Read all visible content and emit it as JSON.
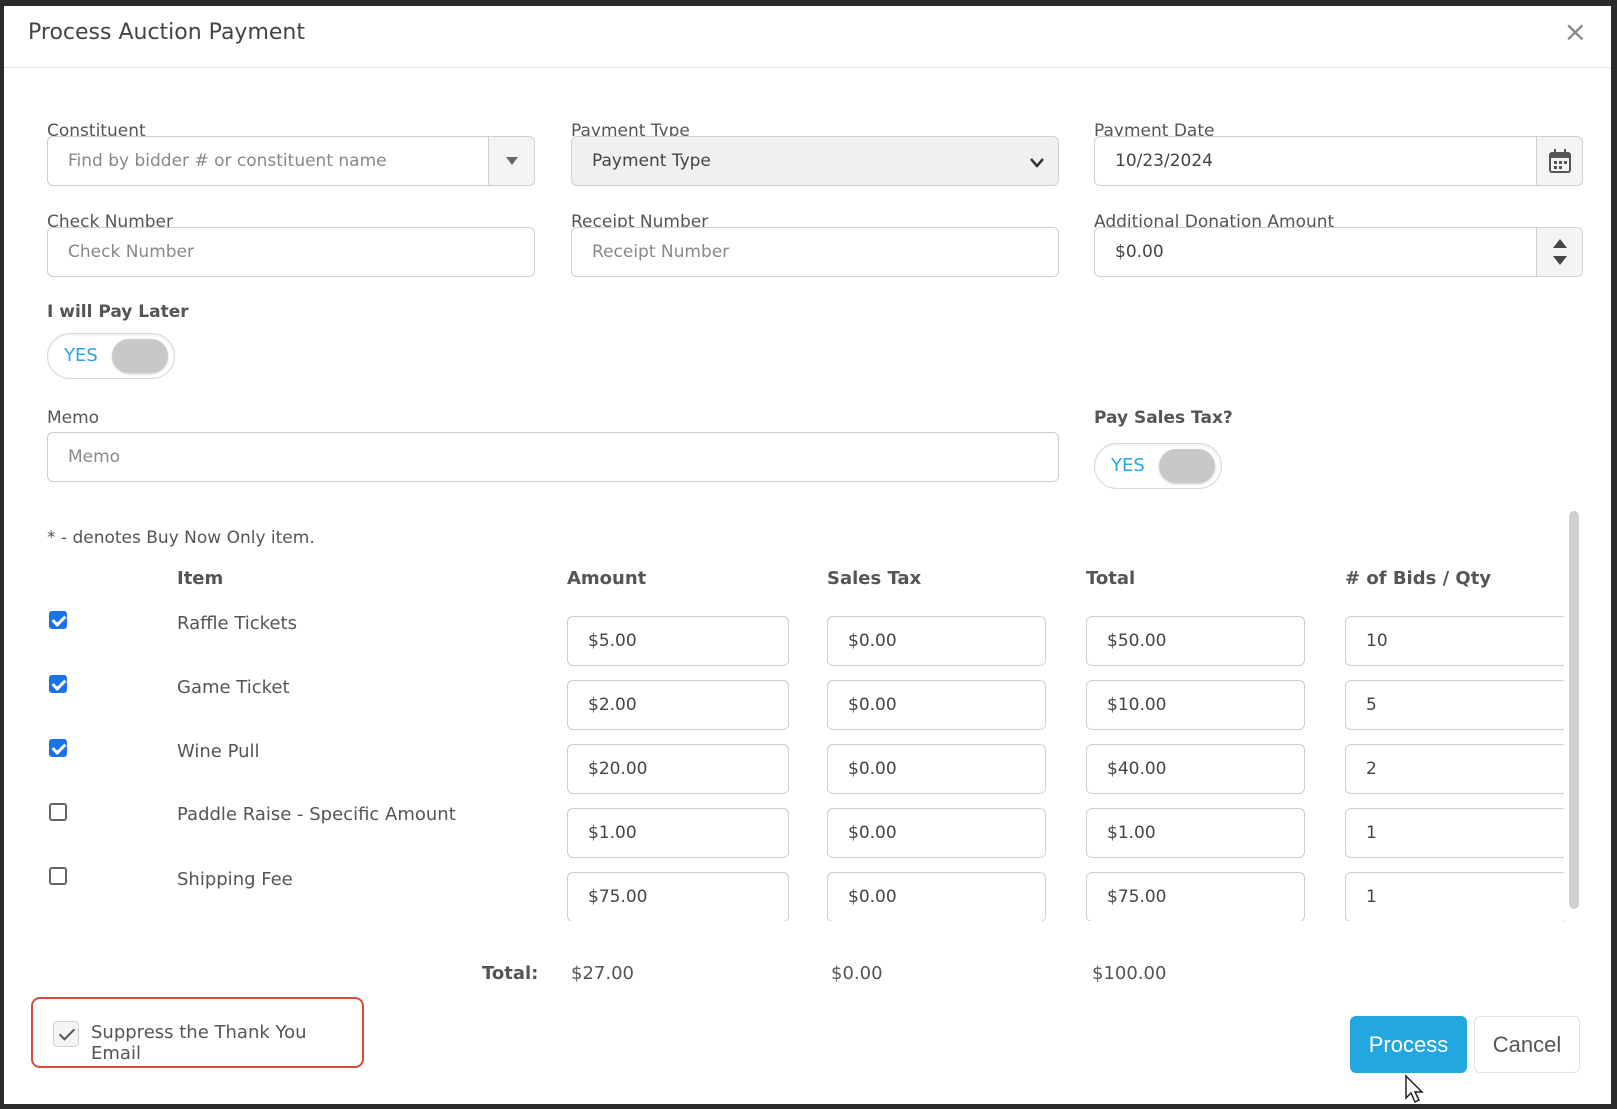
{
  "dialog": {
    "title": "Process Auction Payment",
    "close_glyph": "×"
  },
  "form": {
    "constituent": {
      "label": "Constituent",
      "placeholder": "Find by bidder # or constituent name"
    },
    "payment_type": {
      "label": "Payment Type",
      "value": "Payment Type"
    },
    "payment_date": {
      "label": "Payment Date",
      "value": "10/23/2024"
    },
    "check_number": {
      "label": "Check Number",
      "placeholder": "Check Number"
    },
    "receipt_number": {
      "label": "Receipt Number",
      "placeholder": "Receipt Number"
    },
    "additional_donation": {
      "label": "Additional Donation Amount",
      "value": "$0.00"
    },
    "pay_later": {
      "label": "I will Pay Later",
      "toggle_text": "YES"
    },
    "memo": {
      "label": "Memo",
      "placeholder": "Memo"
    },
    "pay_sales_tax": {
      "label": "Pay Sales Tax?",
      "toggle_text": "YES"
    }
  },
  "items_table": {
    "note": "* - denotes Buy Now Only item.",
    "headers": {
      "item": "Item",
      "amount": "Amount",
      "sales_tax": "Sales Tax",
      "total": "Total",
      "qty": "# of Bids / Qty"
    },
    "rows": [
      {
        "checked": true,
        "item": "Raffle Tickets",
        "amount": "$5.00",
        "sales_tax": "$0.00",
        "total": "$50.00",
        "qty": "10"
      },
      {
        "checked": true,
        "item": "Game Ticket",
        "amount": "$2.00",
        "sales_tax": "$0.00",
        "total": "$10.00",
        "qty": "5"
      },
      {
        "checked": true,
        "item": "Wine Pull",
        "amount": "$20.00",
        "sales_tax": "$0.00",
        "total": "$40.00",
        "qty": "2"
      },
      {
        "checked": false,
        "item": "Paddle Raise - Specific Amount",
        "amount": "$1.00",
        "sales_tax": "$0.00",
        "total": "$1.00",
        "qty": "1"
      },
      {
        "checked": false,
        "item": "Shipping Fee",
        "amount": "$75.00",
        "sales_tax": "$0.00",
        "total": "$75.00",
        "qty": "1"
      }
    ],
    "totals": {
      "label": "Total:",
      "amount": "$27.00",
      "sales_tax": "$0.00",
      "total": "$100.00"
    }
  },
  "footer": {
    "suppress_email": {
      "label": "Suppress the Thank You Email",
      "checked": true
    },
    "process_label": "Process",
    "cancel_label": "Cancel"
  },
  "colors": {
    "accent": "#22a7df",
    "toggle_text": "#29a5df",
    "highlight_border": "#d94a3a",
    "checkbox_checked": "#1a73e8"
  }
}
